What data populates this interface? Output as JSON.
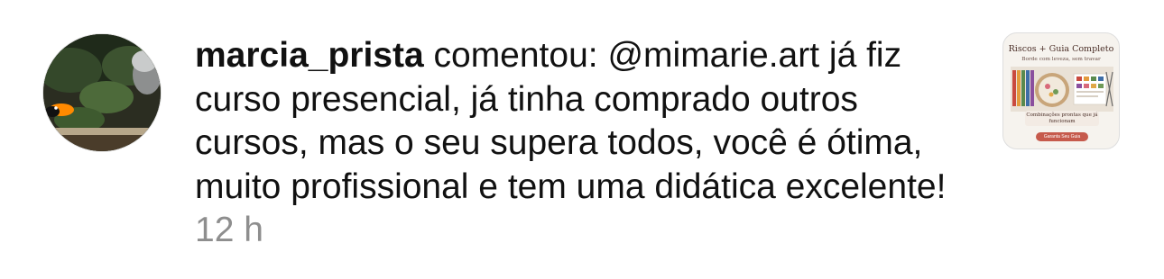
{
  "notification": {
    "username": "marcia_prista",
    "action": "comentou:",
    "mention": "@mimarie.art",
    "comment_text": "já fiz curso presencial, já tinha comprado outros cursos, mas o seu supera todos, você é ótima, muito profissional e tem uma didática excelente!",
    "timestamp": "12 h"
  },
  "post_thumbnail": {
    "title": "Riscos + Guia Completo",
    "subtitle": "Borde com leveza, sem travar",
    "caption": "Combinações prontas que já funcionam",
    "button_label": "Garanta Seu Guia"
  },
  "colors": {
    "text": "#111111",
    "timestamp": "#8e8e8e",
    "thumbnail_button": "#c65a4c"
  }
}
